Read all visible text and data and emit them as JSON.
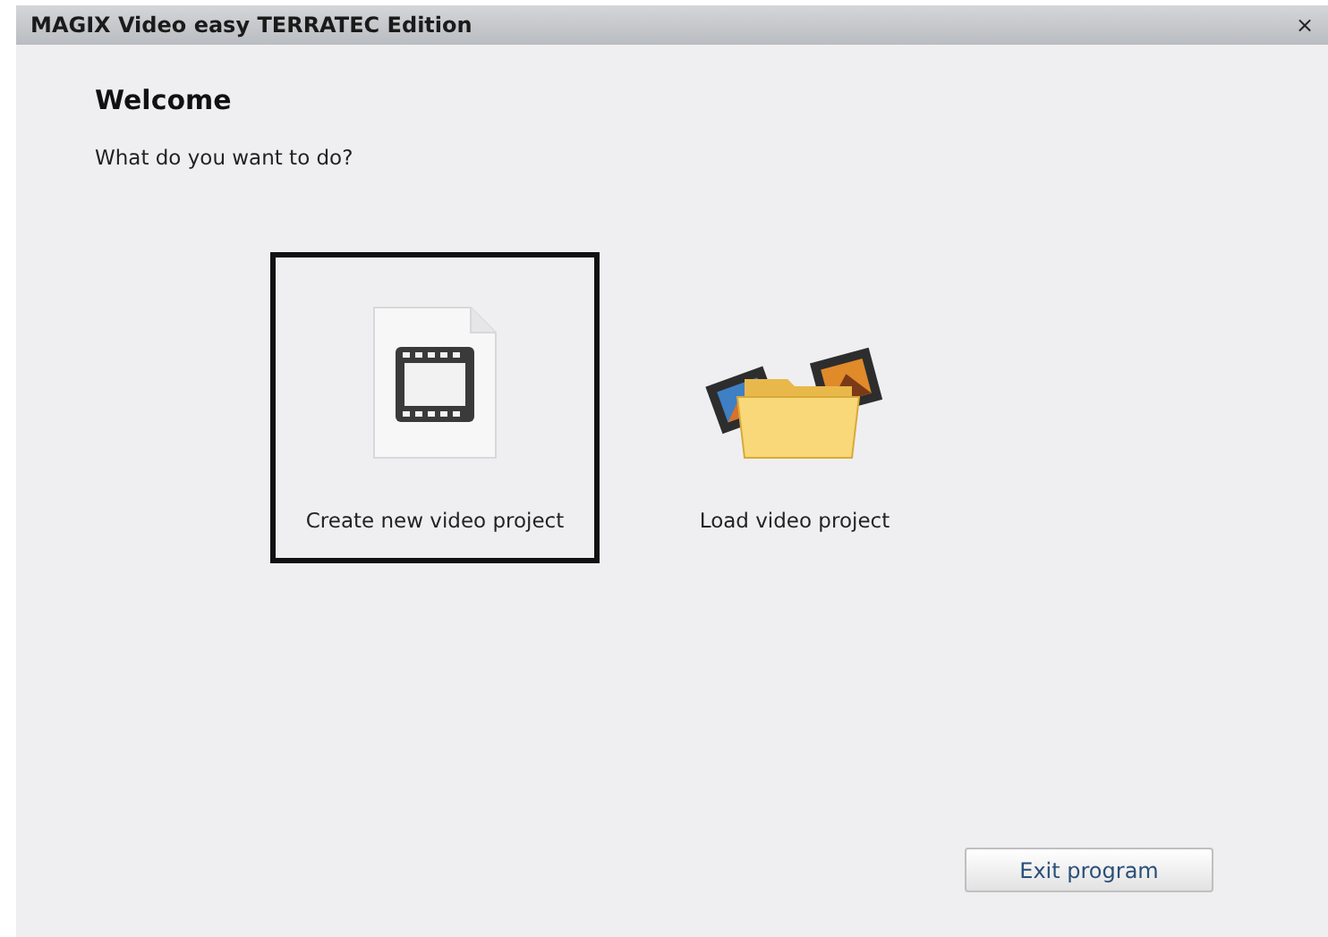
{
  "window": {
    "title": "MAGIX Video easy TERRATEC Edition",
    "close": "×"
  },
  "heading": "Welcome",
  "prompt": "What do you want to do?",
  "options": [
    {
      "kind": "new",
      "label": "Create new video project",
      "selected": true
    },
    {
      "kind": "load",
      "label": "Load video project",
      "selected": false
    }
  ],
  "buttons": [
    "Exit program"
  ]
}
